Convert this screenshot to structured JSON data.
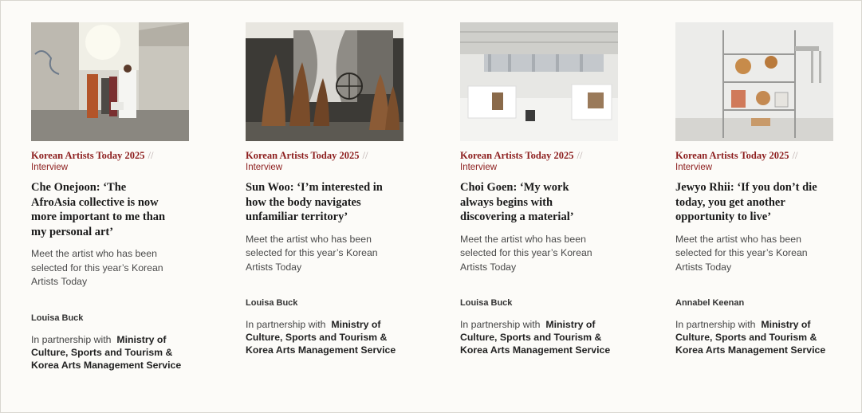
{
  "cards": [
    {
      "kicker": "Korean Artists Today 2025",
      "separator": "//",
      "type": "Interview",
      "headline": "Che Onejoon: ‘The AfroAsia collective is now more important to me than my personal art’",
      "standfirst": "Meet the artist who has been selected for this year’s Korean Artists Today",
      "author": "Louisa Buck",
      "partner_prefix": "In partnership with",
      "partner_name": "Ministry of Culture, Sports and Tourism & Korea Arts Management Service"
    },
    {
      "kicker": "Korean Artists Today 2025",
      "separator": "//",
      "type": "Interview",
      "headline": "Sun Woo: ‘I’m interested in how the body navigates unfamiliar territory’",
      "standfirst": "Meet the artist who has been selected for this year’s Korean Artists Today",
      "author": "Louisa Buck",
      "partner_prefix": "In partnership with",
      "partner_name": "Ministry of Culture, Sports and Tourism & Korea Arts Management Service"
    },
    {
      "kicker": "Korean Artists Today 2025",
      "separator": "//",
      "type": "Interview",
      "headline": "Choi Goen: ‘My work always begins with discovering a material’",
      "standfirst": "Meet the artist who has been selected for this year’s Korean Artists Today",
      "author": "Louisa Buck",
      "partner_prefix": "In partnership with",
      "partner_name": "Ministry of Culture, Sports and Tourism & Korea Arts Management Service"
    },
    {
      "kicker": "Korean Artists Today 2025",
      "separator": "//",
      "type": "Interview",
      "headline": "Jewyo Rhii: ‘If you don’t die today, you get another opportunity to live’",
      "standfirst": "Meet the artist who has been selected for this year’s Korean Artists Today",
      "author": "Annabel Keenan",
      "partner_prefix": "In partnership with",
      "partner_name": "Ministry of Culture, Sports and Tourism & Korea Arts Management Service"
    }
  ],
  "colors": {
    "kicker": "#8c1d1d",
    "background": "#fcfbf8"
  }
}
